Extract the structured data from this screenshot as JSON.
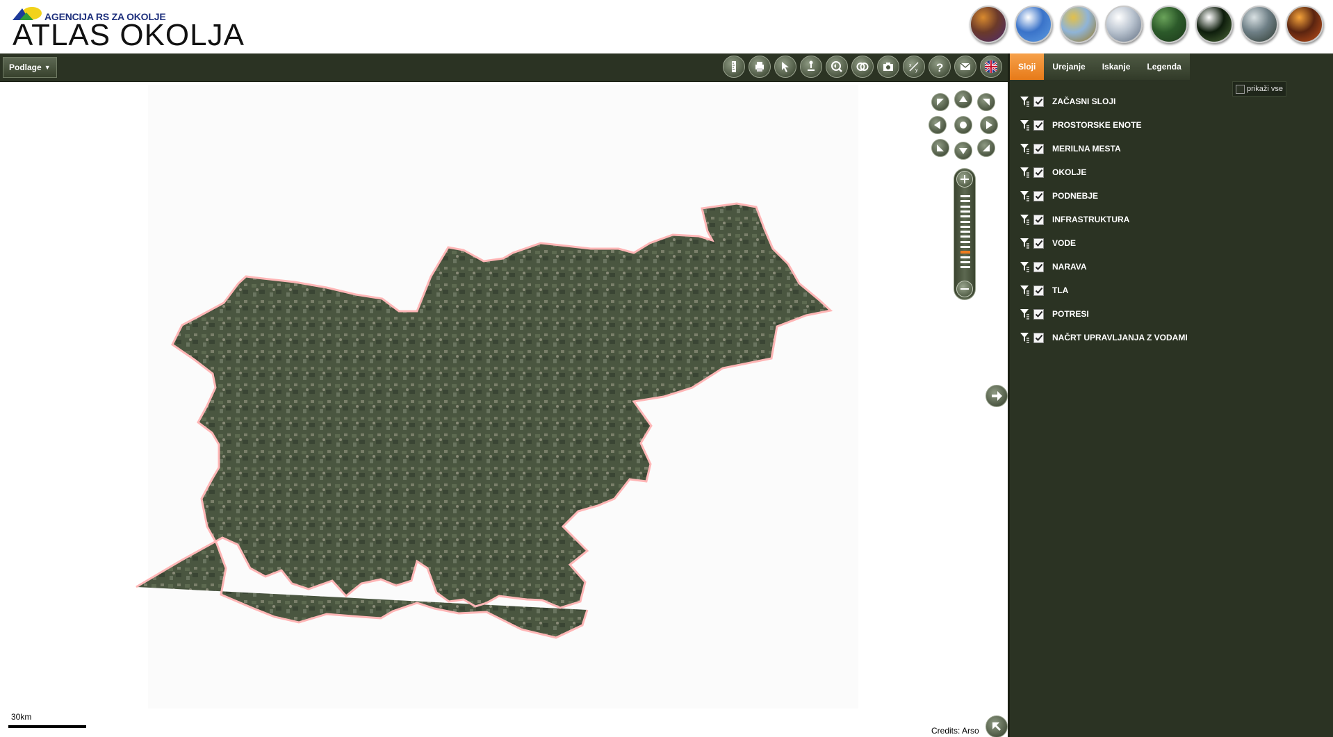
{
  "header": {
    "agency": "AGENCIJA RS ZA OKOLJE",
    "title": "ATLAS OKOLJA",
    "logo_colors": {
      "blue": "#1d3a9a",
      "yellow": "#f2d21b",
      "green": "#2f9c3a"
    },
    "themes": [
      {
        "name": "theme-map",
        "colors": [
          "#6b3a2a",
          "#d98a2e",
          "#4d2a6e"
        ]
      },
      {
        "name": "theme-sky",
        "colors": [
          "#3a73c9",
          "#ffffff",
          "#5d9be0"
        ]
      },
      {
        "name": "theme-field",
        "colors": [
          "#8fb4d8",
          "#e2c04a",
          "#9c7a20"
        ]
      },
      {
        "name": "theme-winter",
        "colors": [
          "#b9c3cf",
          "#ffffff",
          "#5f6d80"
        ]
      },
      {
        "name": "theme-grass",
        "colors": [
          "#2c5a2a",
          "#6aa35a",
          "#1d3a1b"
        ]
      },
      {
        "name": "theme-dandelion",
        "colors": [
          "#0e1d0c",
          "#ffffff",
          "#4e6b3a"
        ]
      },
      {
        "name": "theme-lake",
        "colors": [
          "#6e7f86",
          "#d9e1e3",
          "#2e3a30"
        ]
      },
      {
        "name": "theme-fire",
        "colors": [
          "#5a2410",
          "#f5a33a",
          "#c2521a"
        ]
      }
    ]
  },
  "toolbar": {
    "basemap_label": "Podlage",
    "tools": [
      "ruler-icon",
      "print-icon",
      "pointer-icon",
      "pin-icon",
      "zoom-extent-icon",
      "compare-icon",
      "camera-icon",
      "coordinates-icon",
      "help-icon",
      "mail-icon",
      "uk-flag-icon"
    ]
  },
  "map": {
    "scale_label": "30km",
    "credits": "Credits: Arso",
    "zoom_level": 3,
    "zoom_levels": 15
  },
  "panel": {
    "tabs": [
      {
        "label": "Sloji",
        "active": true
      },
      {
        "label": "Urejanje",
        "active": false
      },
      {
        "label": "Iskanje",
        "active": false
      },
      {
        "label": "Legenda",
        "active": false
      }
    ],
    "show_all_label": "prikaži vse",
    "layers": [
      {
        "label": "ZAČASNI SLOJI",
        "checked": true
      },
      {
        "label": "PROSTORSKE ENOTE",
        "checked": true
      },
      {
        "label": "MERILNA MESTA",
        "checked": true
      },
      {
        "label": "OKOLJE",
        "checked": true
      },
      {
        "label": "PODNEBJE",
        "checked": true
      },
      {
        "label": "INFRASTRUKTURA",
        "checked": true
      },
      {
        "label": "VODE",
        "checked": true
      },
      {
        "label": "NARAVA",
        "checked": true
      },
      {
        "label": "TLA",
        "checked": true
      },
      {
        "label": "POTRESI",
        "checked": true
      },
      {
        "label": "NAČRT UPRAVLJANJA Z VODAMI",
        "checked": true
      }
    ]
  },
  "colors": {
    "panel_bg": "#2b3323",
    "accent": "#e77b19",
    "border_line": "#ffb6b6"
  }
}
